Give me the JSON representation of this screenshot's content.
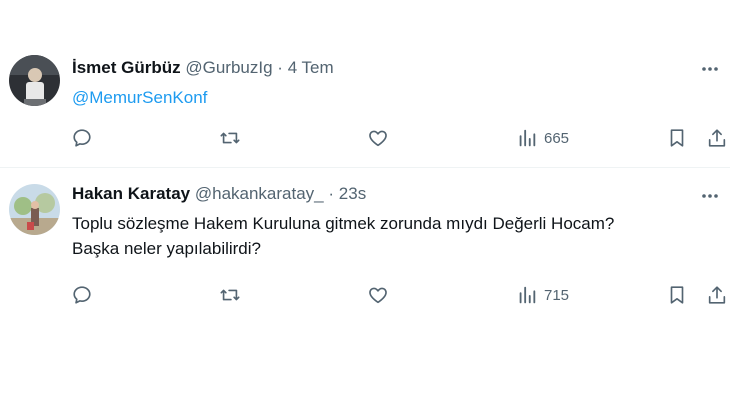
{
  "tweets": [
    {
      "name": "İsmet Gürbüz",
      "handle": "@GurbuzIg",
      "time": "4 Tem",
      "text": "@MemurSenKonf",
      "views": "665"
    },
    {
      "name": "Hakan Karatay",
      "handle": "@hakankaratay_",
      "time": "23s",
      "text_line1": "Toplu sözleşme Hakem Kuruluna gitmek zorunda mıydı Değerli Hocam?",
      "text_line2": "Başka neler yapılabilirdi?",
      "views": "715"
    }
  ],
  "separator": "·",
  "icons": [
    "reply-icon",
    "retweet-icon",
    "like-icon",
    "views-icon",
    "bookmark-icon",
    "share-icon",
    "more-icon"
  ],
  "colors": {
    "link": "#1d9bf0",
    "secondary": "#536471",
    "text": "#0f1419"
  }
}
